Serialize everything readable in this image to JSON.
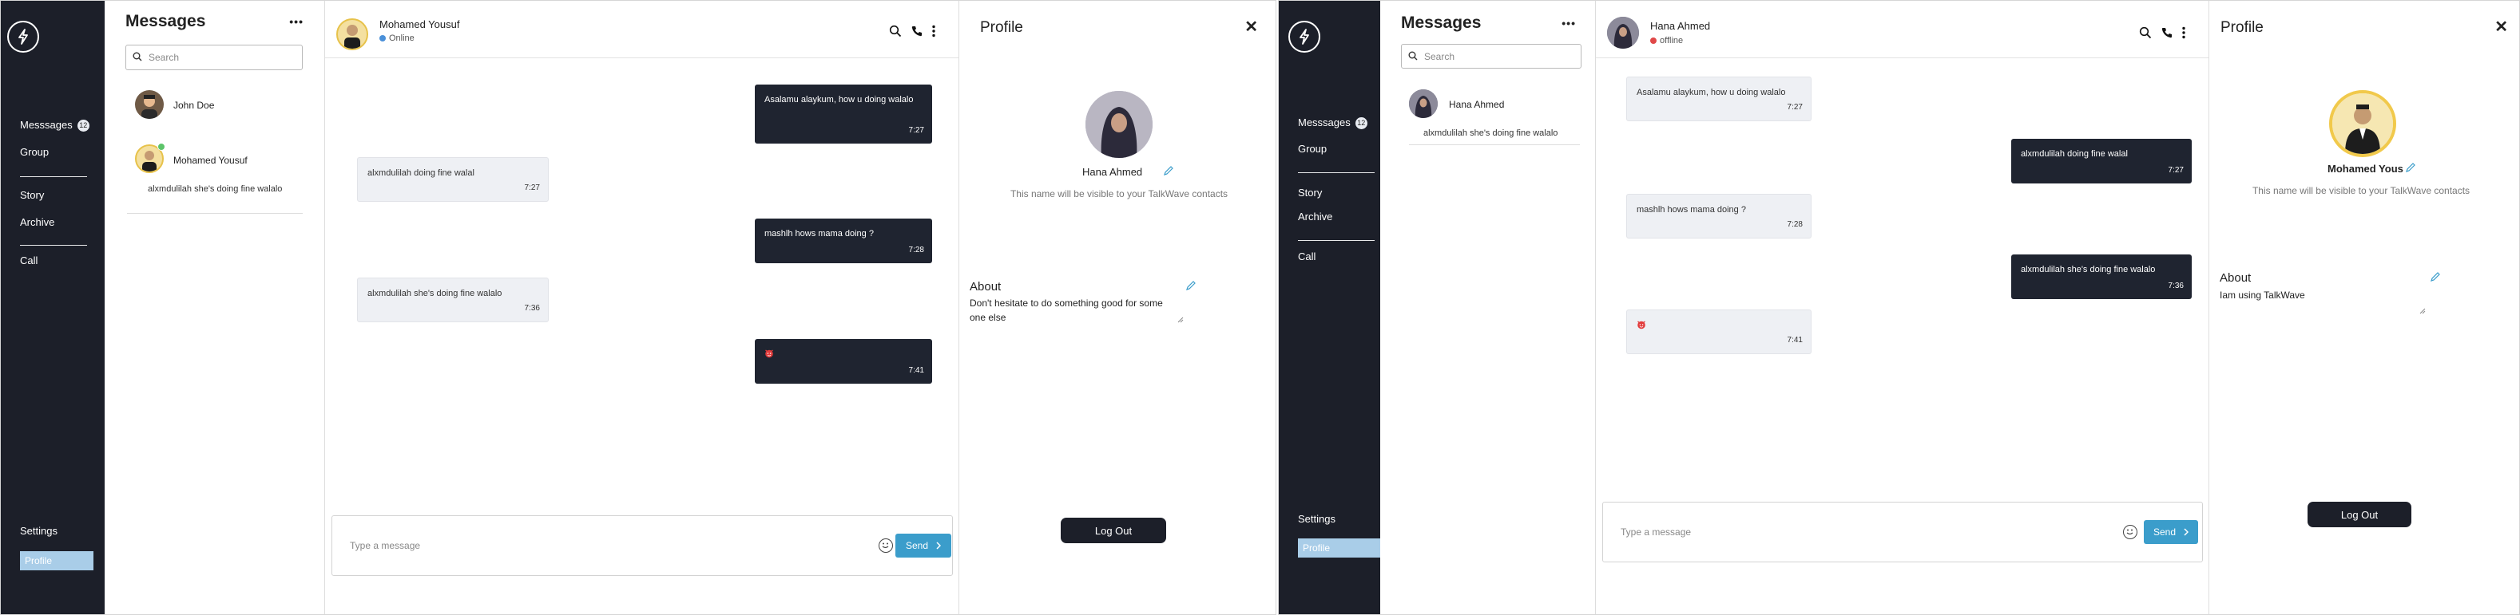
{
  "colors": {
    "rail": "#1c1f29",
    "accent": "#3b9dcb",
    "online": "#4a90d9",
    "offline": "#e04848",
    "profile_pill": "#a9cde8",
    "me_bubble": "#1f2430",
    "them_bubble": "#eef0f4"
  },
  "app1": {
    "nav": {
      "messages": "Messsages",
      "badge": "12",
      "group": "Group",
      "story": "Story",
      "archive": "Archive",
      "call": "Call",
      "settings": "Settings",
      "profile": "Profile"
    },
    "sidebar": {
      "title": "Messages",
      "search_placeholder": "Search",
      "contacts": [
        {
          "name": "John Doe",
          "preview": ""
        },
        {
          "name": "Mohamed Yousuf",
          "preview": "alxmdulilah she's doing fine walalo"
        }
      ]
    },
    "chat": {
      "name": "Mohamed Yousuf",
      "status": "Online",
      "messages": [
        {
          "from": "me",
          "text": "Asalamu alaykum, how u doing walalo",
          "time": "7:27"
        },
        {
          "from": "them",
          "text": "alxmdulilah doing fine walal",
          "time": "7:27"
        },
        {
          "from": "me",
          "text": "mashlh hows mama doing ?",
          "time": "7:28"
        },
        {
          "from": "them",
          "text": "alxmdulilah she's doing fine walalo",
          "time": "7:36"
        },
        {
          "from": "me",
          "text": "",
          "time": "7:41",
          "emoji": "devil-emoji"
        }
      ],
      "composer_placeholder": "Type a message",
      "send_label": "Send"
    },
    "profile": {
      "title": "Profile",
      "close": "✕",
      "name": "Hana Ahmed",
      "note": "This name will be visible to your TalkWave contacts",
      "about_title": "About",
      "about_text": "Don't hesitate to do something good for some one else",
      "logout": "Log Out"
    }
  },
  "app2": {
    "nav": {
      "messages": "Messsages",
      "badge": "12",
      "group": "Group",
      "story": "Story",
      "archive": "Archive",
      "call": "Call",
      "settings": "Settings",
      "profile": "Profile"
    },
    "sidebar": {
      "title": "Messages",
      "search_placeholder": "Search",
      "contacts": [
        {
          "name": "Hana Ahmed",
          "preview": "alxmdulilah she's doing fine walalo"
        }
      ]
    },
    "chat": {
      "name": "Hana Ahmed",
      "status": "offline",
      "messages": [
        {
          "from": "them",
          "text": "Asalamu alaykum, how u doing walalo",
          "time": "7:27"
        },
        {
          "from": "me",
          "text": "alxmdulilah doing fine walal",
          "time": "7:27"
        },
        {
          "from": "them",
          "text": "mashlh hows mama doing ?",
          "time": "7:28"
        },
        {
          "from": "me",
          "text": "alxmdulilah she's doing fine walalo",
          "time": "7:36"
        },
        {
          "from": "them",
          "text": "",
          "time": "7:41",
          "emoji": "devil-emoji"
        }
      ],
      "composer_placeholder": "Type a message",
      "send_label": "Send"
    },
    "profile": {
      "title": "Profile",
      "close": "✕",
      "name": "Mohamed Yous",
      "note": "This name will be visible to your TalkWave contacts",
      "about_title": "About",
      "about_text": "Iam using TalkWave",
      "logout": "Log Out"
    }
  }
}
